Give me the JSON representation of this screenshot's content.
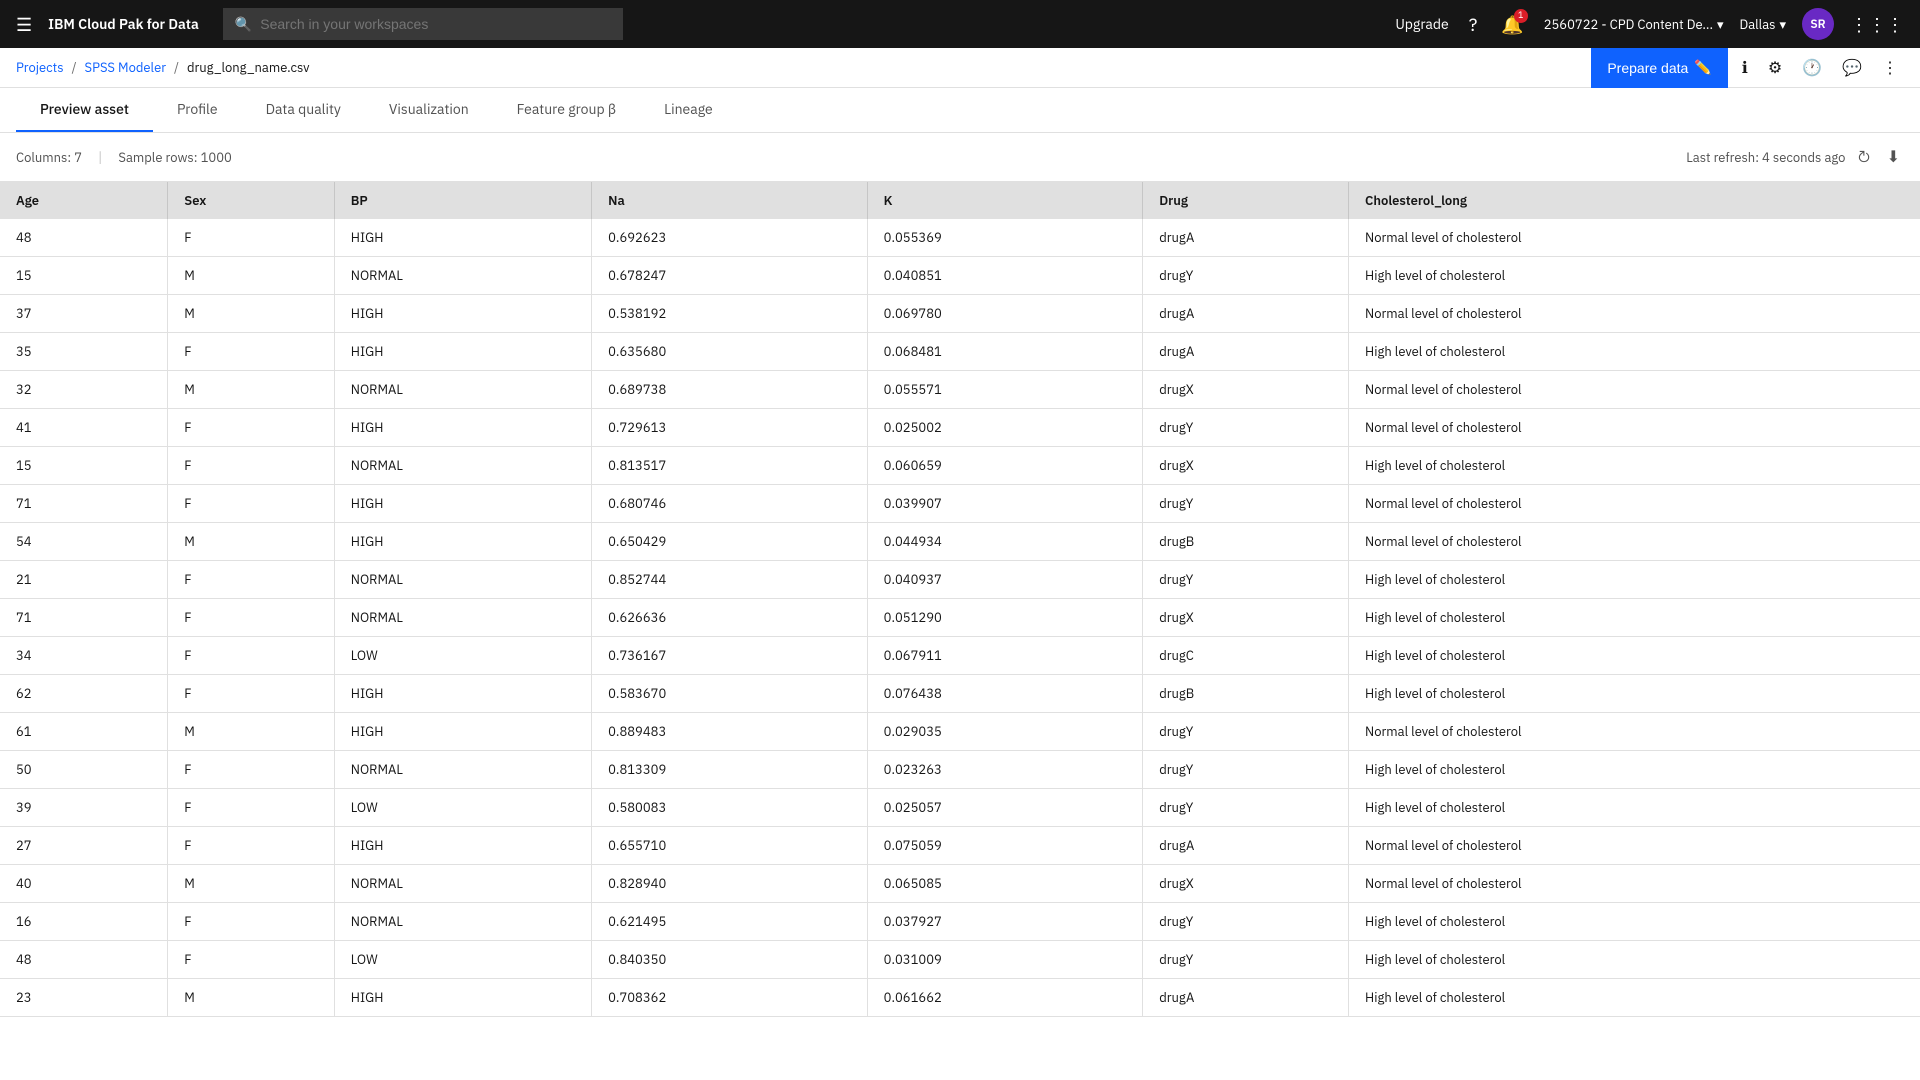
{
  "app": {
    "name": "IBM Cloud Pak for Data"
  },
  "nav": {
    "search_placeholder": "Search in your workspaces",
    "upgrade_label": "Upgrade",
    "account": "2560722 - CPD Content De...",
    "region": "Dallas",
    "avatar_initials": "SR",
    "notification_count": "1"
  },
  "breadcrumb": {
    "projects": "Projects",
    "spss": "SPSS Modeler",
    "file": "drug_long_name.csv",
    "prepare_label": "Prepare data"
  },
  "tabs": [
    {
      "id": "preview-asset",
      "label": "Preview asset",
      "active": true
    },
    {
      "id": "profile",
      "label": "Profile",
      "active": false
    },
    {
      "id": "data-quality",
      "label": "Data quality",
      "active": false
    },
    {
      "id": "visualization",
      "label": "Visualization",
      "active": false
    },
    {
      "id": "feature-group",
      "label": "Feature group β",
      "active": false
    },
    {
      "id": "lineage",
      "label": "Lineage",
      "active": false
    }
  ],
  "toolbar": {
    "columns_label": "Columns: 7",
    "sep": "|",
    "sample_rows_label": "Sample rows: 1000",
    "refresh_label": "Last refresh: 4 seconds ago"
  },
  "table": {
    "columns": [
      "Age",
      "Sex",
      "BP",
      "Na",
      "K",
      "Drug",
      "Cholesterol_long"
    ],
    "rows": [
      [
        "48",
        "F",
        "HIGH",
        "0.692623",
        "0.055369",
        "drugA",
        "Normal level of cholesterol"
      ],
      [
        "15",
        "M",
        "NORMAL",
        "0.678247",
        "0.040851",
        "drugY",
        "High level of cholesterol"
      ],
      [
        "37",
        "M",
        "HIGH",
        "0.538192",
        "0.069780",
        "drugA",
        "Normal level of cholesterol"
      ],
      [
        "35",
        "F",
        "HIGH",
        "0.635680",
        "0.068481",
        "drugA",
        "High level of cholesterol"
      ],
      [
        "32",
        "M",
        "NORMAL",
        "0.689738",
        "0.055571",
        "drugX",
        "Normal level of cholesterol"
      ],
      [
        "41",
        "F",
        "HIGH",
        "0.729613",
        "0.025002",
        "drugY",
        "Normal level of cholesterol"
      ],
      [
        "15",
        "F",
        "NORMAL",
        "0.813517",
        "0.060659",
        "drugX",
        "High level of cholesterol"
      ],
      [
        "71",
        "F",
        "HIGH",
        "0.680746",
        "0.039907",
        "drugY",
        "Normal level of cholesterol"
      ],
      [
        "54",
        "M",
        "HIGH",
        "0.650429",
        "0.044934",
        "drugB",
        "Normal level of cholesterol"
      ],
      [
        "21",
        "F",
        "NORMAL",
        "0.852744",
        "0.040937",
        "drugY",
        "High level of cholesterol"
      ],
      [
        "71",
        "F",
        "NORMAL",
        "0.626636",
        "0.051290",
        "drugX",
        "High level of cholesterol"
      ],
      [
        "34",
        "F",
        "LOW",
        "0.736167",
        "0.067911",
        "drugC",
        "High level of cholesterol"
      ],
      [
        "62",
        "F",
        "HIGH",
        "0.583670",
        "0.076438",
        "drugB",
        "High level of cholesterol"
      ],
      [
        "61",
        "M",
        "HIGH",
        "0.889483",
        "0.029035",
        "drugY",
        "Normal level of cholesterol"
      ],
      [
        "50",
        "F",
        "NORMAL",
        "0.813309",
        "0.023263",
        "drugY",
        "High level of cholesterol"
      ],
      [
        "39",
        "F",
        "LOW",
        "0.580083",
        "0.025057",
        "drugY",
        "High level of cholesterol"
      ],
      [
        "27",
        "F",
        "HIGH",
        "0.655710",
        "0.075059",
        "drugA",
        "Normal level of cholesterol"
      ],
      [
        "40",
        "M",
        "NORMAL",
        "0.828940",
        "0.065085",
        "drugX",
        "Normal level of cholesterol"
      ],
      [
        "16",
        "F",
        "NORMAL",
        "0.621495",
        "0.037927",
        "drugY",
        "High level of cholesterol"
      ],
      [
        "48",
        "F",
        "LOW",
        "0.840350",
        "0.031009",
        "drugY",
        "High level of cholesterol"
      ],
      [
        "23",
        "M",
        "HIGH",
        "0.708362",
        "0.061662",
        "drugA",
        "High level of cholesterol"
      ]
    ]
  }
}
